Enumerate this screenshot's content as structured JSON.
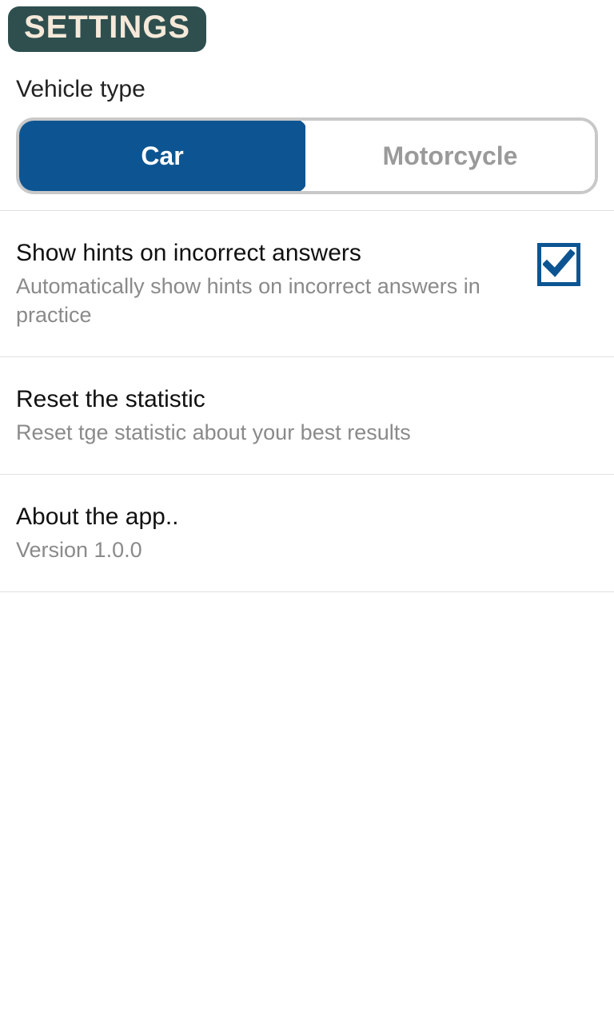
{
  "header": {
    "title": "SETTINGS"
  },
  "vehicleType": {
    "label": "Vehicle type",
    "options": {
      "car": "Car",
      "motorcycle": "Motorcycle"
    },
    "selected": "car"
  },
  "settings": {
    "hints": {
      "title": "Show hints on incorrect answers",
      "subtitle": "Automatically show hints on incorrect answers in practice",
      "checked": true
    },
    "reset": {
      "title": "Reset the statistic",
      "subtitle": "Reset tge statistic about your best results"
    },
    "about": {
      "title": "About the app..",
      "subtitle": "Version 1.0.0"
    }
  }
}
